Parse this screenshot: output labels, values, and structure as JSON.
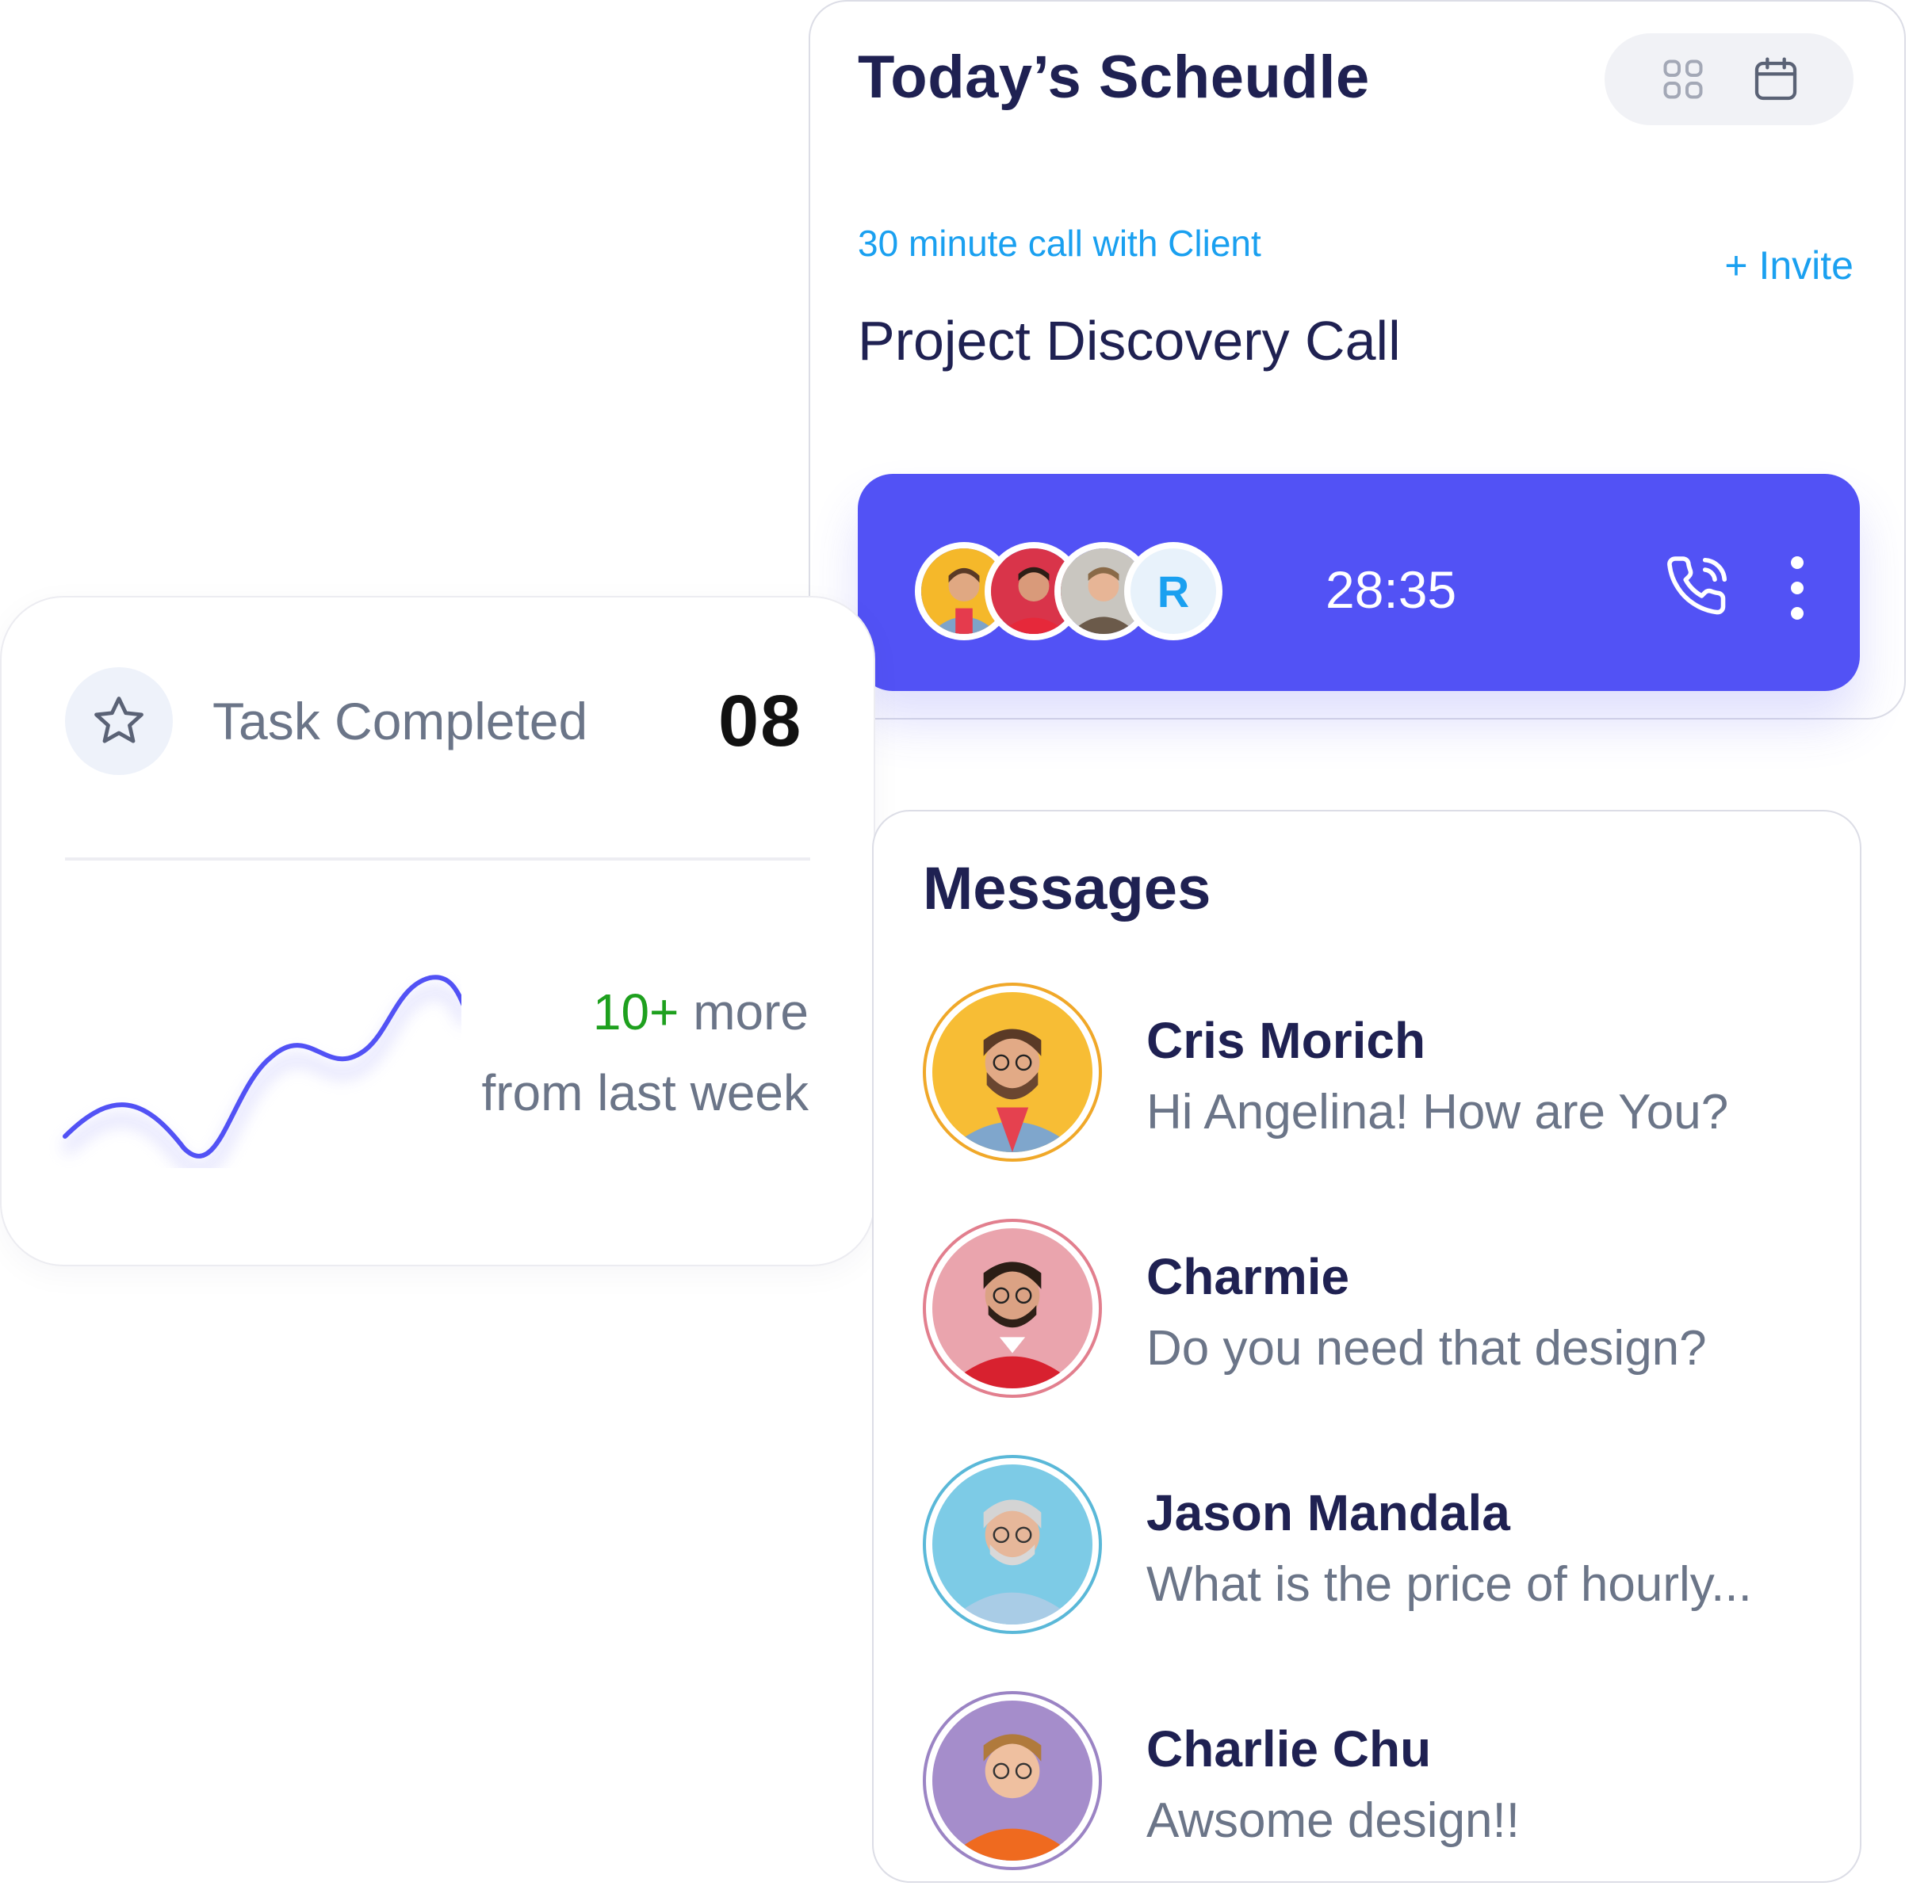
{
  "schedule": {
    "title": "Today’s Scheudle",
    "call_subtitle": "30 minute call with Client",
    "invite_label": "+ Invite",
    "call_title": "Project Discovery Call",
    "timer": "28:35",
    "participant_initial": "R",
    "icons": [
      "grid-icon",
      "calendar-icon",
      "phone-call-icon",
      "more-vertical-icon"
    ]
  },
  "task": {
    "label": "Task Completed",
    "count": "08",
    "trend_highlight": "10+",
    "trend_more": " more",
    "trend_sub": "from last week",
    "icons": [
      "star-icon"
    ]
  },
  "messages": {
    "title": "Messages",
    "items": [
      {
        "name": "Cris Morich",
        "text": "Hi Angelina! How are You?"
      },
      {
        "name": "Charmie",
        "text": "Do you need that design?"
      },
      {
        "name": "Jason Mandala",
        "text": "What is the price of hourly..."
      },
      {
        "name": "Charlie Chu",
        "text": "Awsome design!!"
      }
    ]
  },
  "colors": {
    "navy": "#1f2152",
    "accent_blue": "#1aa0f0",
    "call_bar": "#5252f5",
    "muted_text": "#6b7588",
    "highlight_green": "#1ea01e"
  }
}
